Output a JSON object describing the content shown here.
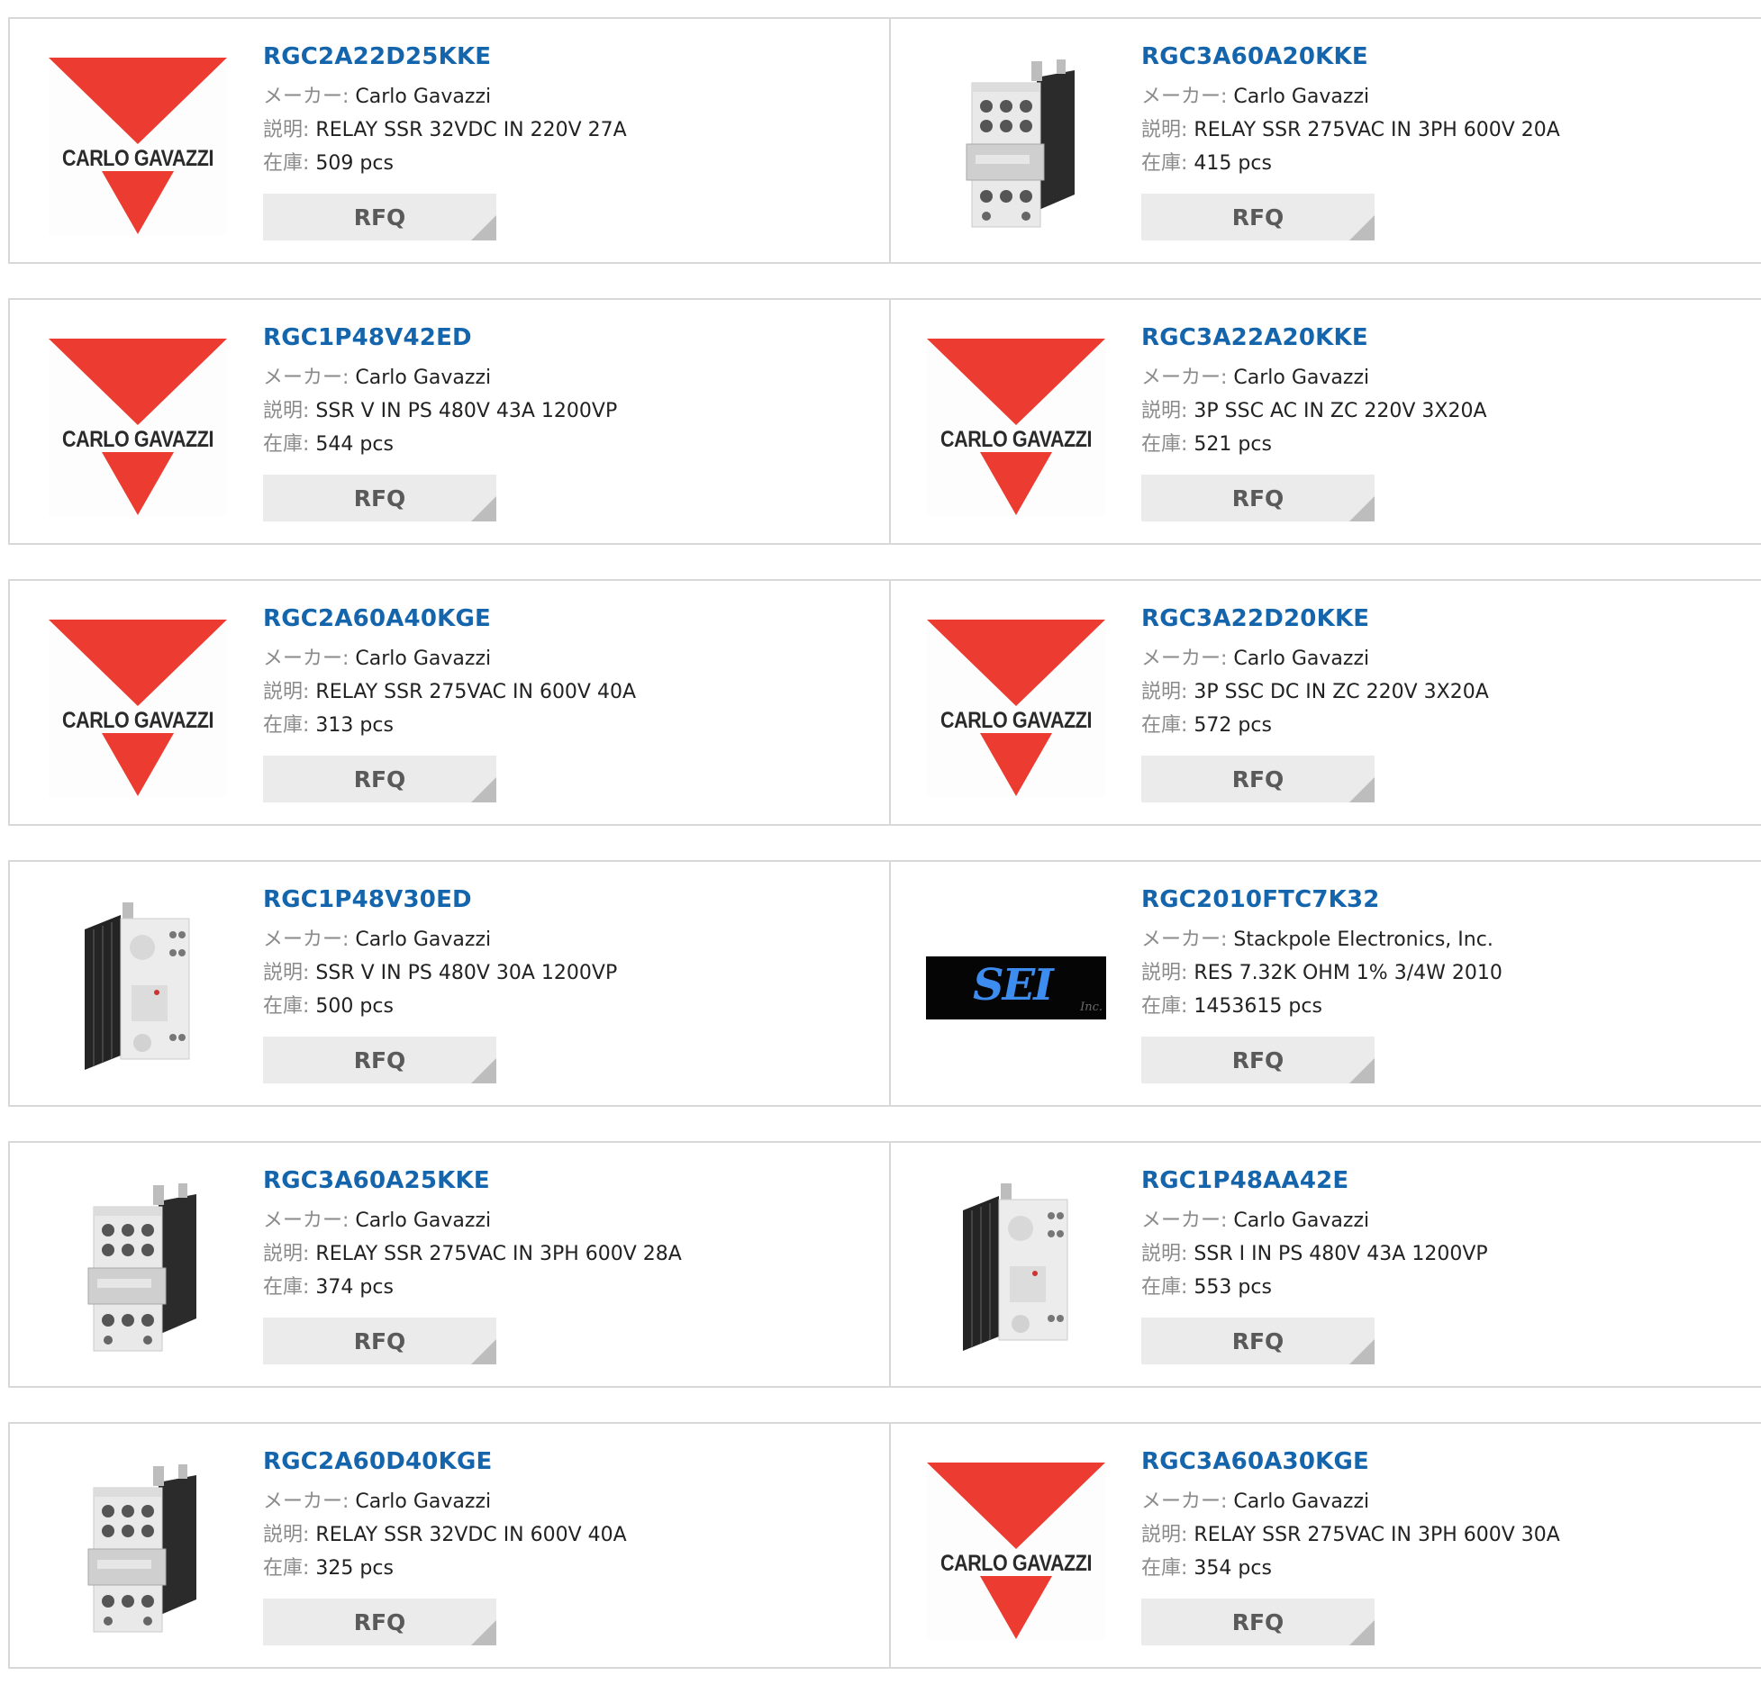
{
  "labels": {
    "maker": "メーカー:",
    "desc": "説明:",
    "stock": "在庫:",
    "rfq": "RFQ"
  },
  "brand_logo_text": {
    "carlo_gavazzi": "CARLO GAVAZZI",
    "sei": "SEI",
    "sei_inc": "Inc."
  },
  "colors": {
    "part_link": "#1565ad",
    "logo_red": "#ec3b30",
    "rfq_bg": "#ebebeb"
  },
  "products": [
    {
      "part": "RGC2A22D25KKE",
      "maker": "Carlo Gavazzi",
      "desc": "RELAY SSR 32VDC IN 220V 27A",
      "stock": "509 pcs",
      "image": "carlo-gavazzi-logo"
    },
    {
      "part": "RGC3A60A20KKE",
      "maker": "Carlo Gavazzi",
      "desc": "RELAY SSR 275VAC IN 3PH 600V 20A",
      "stock": "415 pcs",
      "image": "relay-3ph-photo"
    },
    {
      "part": "RGC1P48V42ED",
      "maker": "Carlo Gavazzi",
      "desc": "SSR V IN PS 480V 43A 1200VP",
      "stock": "544 pcs",
      "image": "carlo-gavazzi-logo"
    },
    {
      "part": "RGC3A22A20KKE",
      "maker": "Carlo Gavazzi",
      "desc": "3P SSC AC IN ZC 220V 3X20A",
      "stock": "521 pcs",
      "image": "carlo-gavazzi-logo"
    },
    {
      "part": "RGC2A60A40KGE",
      "maker": "Carlo Gavazzi",
      "desc": "RELAY SSR 275VAC IN 600V 40A",
      "stock": "313 pcs",
      "image": "carlo-gavazzi-logo"
    },
    {
      "part": "RGC3A22D20KKE",
      "maker": "Carlo Gavazzi",
      "desc": "3P SSC DC IN ZC 220V 3X20A",
      "stock": "572 pcs",
      "image": "carlo-gavazzi-logo"
    },
    {
      "part": "RGC1P48V30ED",
      "maker": "Carlo Gavazzi",
      "desc": "SSR V IN PS 480V 30A 1200VP",
      "stock": "500 pcs",
      "image": "relay-1ph-photo"
    },
    {
      "part": "RGC2010FTC7K32",
      "maker": "Stackpole Electronics, Inc.",
      "desc": "RES 7.32K OHM 1% 3/4W 2010",
      "stock": "1453615 pcs",
      "image": "sei-logo"
    },
    {
      "part": "RGC3A60A25KKE",
      "maker": "Carlo Gavazzi",
      "desc": "RELAY SSR 275VAC IN 3PH 600V 28A",
      "stock": "374 pcs",
      "image": "relay-3ph-photo"
    },
    {
      "part": "RGC1P48AA42E",
      "maker": "Carlo Gavazzi",
      "desc": "SSR I IN PS 480V 43A 1200VP",
      "stock": "553 pcs",
      "image": "relay-1ph-photo"
    },
    {
      "part": "RGC2A60D40KGE",
      "maker": "Carlo Gavazzi",
      "desc": "RELAY SSR 32VDC IN 600V 40A",
      "stock": "325 pcs",
      "image": "relay-3ph-photo"
    },
    {
      "part": "RGC3A60A30KGE",
      "maker": "Carlo Gavazzi",
      "desc": "RELAY SSR 275VAC IN 3PH 600V 30A",
      "stock": "354 pcs",
      "image": "carlo-gavazzi-logo"
    }
  ]
}
